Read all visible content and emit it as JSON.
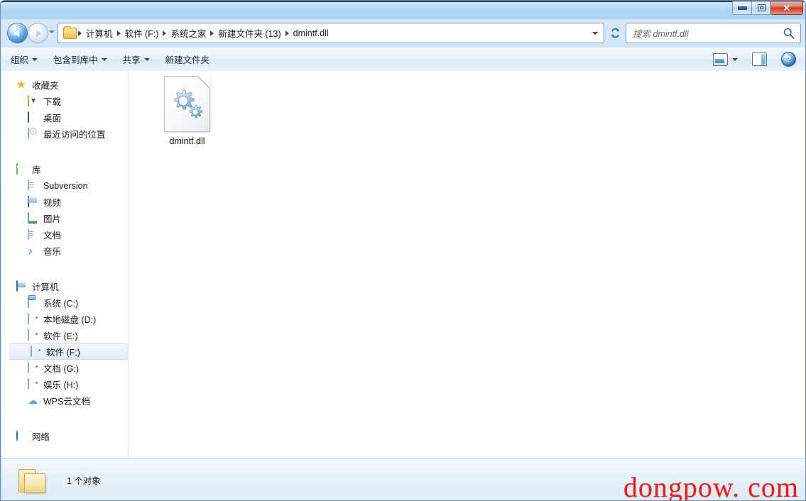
{
  "window": {
    "title": "",
    "controls": {
      "minimize": "–",
      "restore": "□",
      "close": "✕"
    }
  },
  "nav": {
    "back_tooltip": "后退",
    "forward_tooltip": "前进",
    "recent_pages": "▼",
    "refresh": "↻"
  },
  "address": {
    "crumbs": [
      {
        "label": "计算机"
      },
      {
        "label": "软件 (F:)"
      },
      {
        "label": "系统之家"
      },
      {
        "label": "新建文件夹 (13)"
      },
      {
        "label": "dmintf.dll"
      }
    ]
  },
  "search": {
    "placeholder": "搜索 dmintf.dll",
    "value": "",
    "icon": "search-icon"
  },
  "toolbar": {
    "items": [
      {
        "label": "组织",
        "has_caret": true
      },
      {
        "label": "包含到库中",
        "has_caret": true
      },
      {
        "label": "共享",
        "has_caret": true
      },
      {
        "label": "新建文件夹",
        "has_caret": false
      }
    ],
    "right": {
      "view_icon": "view-layout-icon",
      "view_caret": "▼",
      "preview_icon": "preview-pane-icon",
      "help_icon": "help-icon",
      "help_glyph": "?"
    }
  },
  "sidebar": {
    "groups": [
      {
        "header": {
          "label": "收藏夹",
          "icon": "star-icon"
        },
        "items": [
          {
            "label": "下载",
            "icon": "downloads-icon",
            "selected": false
          },
          {
            "label": "桌面",
            "icon": "desktop-icon",
            "selected": false
          },
          {
            "label": "最近访问的位置",
            "icon": "recent-places-icon",
            "selected": false
          }
        ]
      },
      {
        "header": {
          "label": "库",
          "icon": "library-icon"
        },
        "items": [
          {
            "label": "Subversion",
            "icon": "subversion-icon",
            "selected": false
          },
          {
            "label": "视频",
            "icon": "videos-icon",
            "selected": false
          },
          {
            "label": "图片",
            "icon": "pictures-icon",
            "selected": false
          },
          {
            "label": "文档",
            "icon": "documents-icon",
            "selected": false
          },
          {
            "label": "音乐",
            "icon": "music-icon",
            "selected": false
          }
        ]
      },
      {
        "header": {
          "label": "计算机",
          "icon": "computer-icon"
        },
        "items": [
          {
            "label": "系统 (C:)",
            "icon": "system-drive-icon",
            "selected": false
          },
          {
            "label": "本地磁盘 (D:)",
            "icon": "drive-icon",
            "selected": false
          },
          {
            "label": "软件 (E:)",
            "icon": "drive-icon",
            "selected": false
          },
          {
            "label": "软件 (F:)",
            "icon": "drive-icon",
            "selected": true
          },
          {
            "label": "文档 (G:)",
            "icon": "drive-icon",
            "selected": false
          },
          {
            "label": "娱乐 (H:)",
            "icon": "drive-icon",
            "selected": false
          },
          {
            "label": "WPS云文档",
            "icon": "cloud-icon",
            "selected": false
          }
        ]
      },
      {
        "header": {
          "label": "网络",
          "icon": "network-icon"
        },
        "items": []
      }
    ]
  },
  "content": {
    "files": [
      {
        "name": "dmintf.dll",
        "icon": "dll-file-icon",
        "selected": false
      }
    ]
  },
  "statusbar": {
    "folder_icon": "folder-icon",
    "text": "1 个对象"
  },
  "watermark": {
    "text": "dongpow. com",
    "color": "#e8201f"
  },
  "colors": {
    "accent": "#2f77bd",
    "frame": "#b4d4f0",
    "close_button": "#c6402a",
    "selection": "#e2ecf5"
  }
}
